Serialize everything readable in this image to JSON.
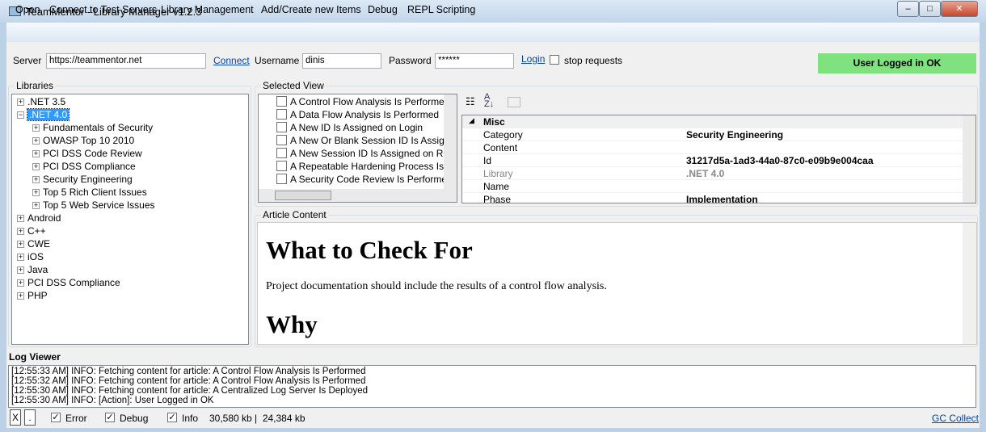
{
  "window": {
    "title": "TeamMentor - Library Manager v1.2.3",
    "minimize": "–",
    "maximize": "□",
    "close": "✕"
  },
  "menu": [
    "Open",
    "Connect to Test Servers",
    "Library Management",
    "Add/Create new Items",
    "Debug",
    "REPL Scripting"
  ],
  "login": {
    "server_label": "Server",
    "server_value": "https://teammentor.net",
    "connect": "Connect",
    "username_label": "Username",
    "username_value": "dinis",
    "password_label": "Password",
    "password_value": "******",
    "login": "Login",
    "stop_requests": "stop requests",
    "status": "User Logged in OK",
    "status_color": "#7fe27f"
  },
  "libraries": {
    "label": "Libraries",
    "items": [
      {
        "label": ".NET 3.5",
        "expanded": false
      },
      {
        "label": ".NET 4.0",
        "expanded": true,
        "selected": true,
        "children": [
          "Fundamentals of Security",
          "OWASP Top 10 2010",
          "PCI DSS Code Review",
          "PCI DSS Compliance",
          "Security Engineering",
          "Top 5 Rich Client Issues",
          "Top 5 Web Service Issues"
        ]
      },
      {
        "label": "Android"
      },
      {
        "label": "C++"
      },
      {
        "label": "CWE"
      },
      {
        "label": "iOS"
      },
      {
        "label": "Java"
      },
      {
        "label": "PCI DSS Compliance"
      },
      {
        "label": "PHP"
      }
    ]
  },
  "selected_view": {
    "label": "Selected View",
    "items": [
      "A Control Flow Analysis Is Performed",
      "A Data Flow Analysis Is Performed",
      "A New ID Is Assigned on Login",
      "A New Or Blank Session ID Is Assigned on",
      "A New Session ID Is Assigned on Reauthentication",
      "A Repeatable Hardening Process Is Established",
      "A Security Code Review Is Performed"
    ]
  },
  "properties": {
    "section": "Misc",
    "rows": [
      {
        "key": "Category",
        "value": "Security Engineering"
      },
      {
        "key": "Content",
        "value": ""
      },
      {
        "key": "Id",
        "value": "31217d5a-1ad3-44a0-87c0-e09b9e004caa"
      },
      {
        "key": "Library",
        "value": ".NET 4.0",
        "disabled": true
      },
      {
        "key": "Name",
        "value": ""
      },
      {
        "key": "Phase",
        "value": "Implementation"
      }
    ]
  },
  "article": {
    "label": "Article Content",
    "h1": "What to Check For",
    "p": "Project documentation should include the results of a control flow analysis.",
    "h2": "Why"
  },
  "log": {
    "label": "Log Viewer",
    "lines": [
      "[12:55:33 AM] INFO: Fetching content for article: A Control Flow Analysis Is Performed",
      "[12:55:32 AM] INFO: Fetching content for article: A Control Flow Analysis Is Performed",
      "[12:55:30 AM] INFO: Fetching content for article: A Centralized Log Server Is Deployed",
      "[12:55:30 AM] INFO: [Action]: User Logged in OK"
    ]
  },
  "statusbar": {
    "x": "X",
    "dot": ".",
    "error": "Error",
    "debug": "Debug",
    "info": "Info",
    "memory": "30,580 kb |  24,384 kb",
    "gc": "GC Collect"
  }
}
